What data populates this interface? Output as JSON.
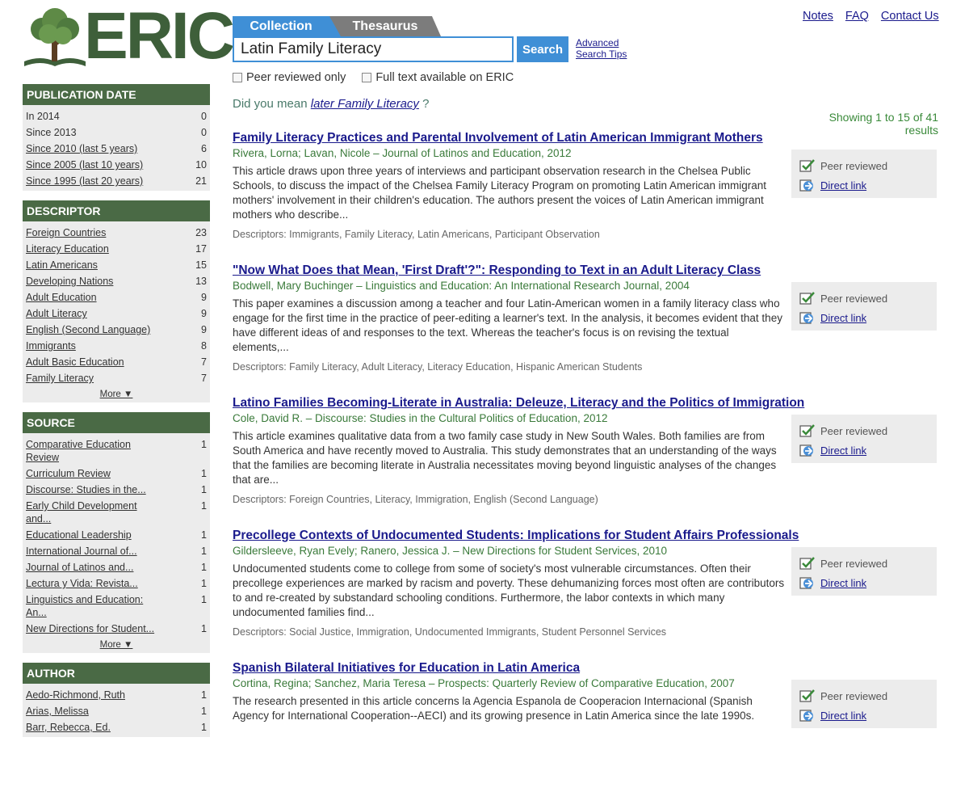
{
  "brand": {
    "logo_text": "ERIC"
  },
  "top_links": [
    "Notes",
    "FAQ",
    "Contact Us"
  ],
  "tabs": {
    "collection": "Collection",
    "thesaurus": "Thesaurus"
  },
  "search": {
    "value": "Latin Family Literacy",
    "button": "Search",
    "advanced": "Advanced",
    "tips": "Search Tips"
  },
  "filters": {
    "peer_reviewed": "Peer reviewed only",
    "full_text": "Full text available on ERIC"
  },
  "did_you_mean": {
    "prefix": "Did you mean",
    "suggestion": "later Family Literacy",
    "suffix": "?"
  },
  "showing": "Showing 1 to 15 of 41 results",
  "facets": {
    "pub_date": {
      "title": "PUBLICATION DATE",
      "items": [
        {
          "label": "In 2014",
          "count": "0",
          "link": false
        },
        {
          "label": "Since 2013",
          "count": "0",
          "link": false
        },
        {
          "label": "Since 2010 (last 5 years)",
          "count": "6",
          "link": true
        },
        {
          "label": "Since 2005 (last 10 years)",
          "count": "10",
          "link": true
        },
        {
          "label": "Since 1995 (last 20 years)",
          "count": "21",
          "link": true
        }
      ]
    },
    "descriptor": {
      "title": "DESCRIPTOR",
      "more": "More ▼",
      "items": [
        {
          "label": "Foreign Countries",
          "count": "23"
        },
        {
          "label": "Literacy Education",
          "count": "17"
        },
        {
          "label": "Latin Americans",
          "count": "15"
        },
        {
          "label": "Developing Nations",
          "count": "13"
        },
        {
          "label": "Adult Education",
          "count": "9"
        },
        {
          "label": "Adult Literacy",
          "count": "9"
        },
        {
          "label": "English (Second Language)",
          "count": "9"
        },
        {
          "label": "Immigrants",
          "count": "8"
        },
        {
          "label": "Adult Basic Education",
          "count": "7"
        },
        {
          "label": "Family Literacy",
          "count": "7"
        }
      ]
    },
    "source": {
      "title": "SOURCE",
      "more": "More ▼",
      "items": [
        {
          "label": "Comparative Education Review",
          "count": "1"
        },
        {
          "label": "Curriculum Review",
          "count": "1"
        },
        {
          "label": "Discourse: Studies in the...",
          "count": "1"
        },
        {
          "label": "Early Child Development and...",
          "count": "1"
        },
        {
          "label": "Educational Leadership",
          "count": "1"
        },
        {
          "label": "International Journal of...",
          "count": "1"
        },
        {
          "label": "Journal of Latinos and...",
          "count": "1"
        },
        {
          "label": "Lectura y Vida: Revista...",
          "count": "1"
        },
        {
          "label": "Linguistics and Education: An...",
          "count": "1"
        },
        {
          "label": "New Directions for Student...",
          "count": "1"
        }
      ]
    },
    "author": {
      "title": "AUTHOR",
      "items": [
        {
          "label": "Aedo-Richmond, Ruth",
          "count": "1"
        },
        {
          "label": "Arias, Melissa",
          "count": "1"
        },
        {
          "label": "Barr, Rebecca, Ed.",
          "count": "1"
        }
      ]
    }
  },
  "result_labels": {
    "peer": "Peer reviewed",
    "direct": "Direct link"
  },
  "results": [
    {
      "title": "Family Literacy Practices and Parental Involvement of Latin American Immigrant Mothers",
      "meta": "Rivera, Lorna; Lavan, Nicole – Journal of Latinos and Education, 2012",
      "abstract": "This article draws upon three years of interviews and participant observation research in the Chelsea Public Schools, to discuss the impact of the Chelsea Family Literacy Program on promoting Latin American immigrant mothers' involvement in their children's education. The authors present the voices of Latin American immigrant mothers who describe...",
      "descriptors": "Descriptors: Immigrants, Family Literacy, Latin Americans, Participant Observation"
    },
    {
      "title": "\"Now What Does that Mean, 'First Draft'?\": Responding to Text in an Adult Literacy Class",
      "meta": "Bodwell, Mary Buchinger – Linguistics and Education: An International Research Journal, 2004",
      "abstract": "This paper examines a discussion among a teacher and four Latin-American women in a family literacy class who engage for the first time in the practice of peer-editing a learner's text. In the analysis, it becomes evident that they have different ideas of and responses to the text. Whereas the teacher's focus is on revising the textual elements,...",
      "descriptors": "Descriptors: Family Literacy, Adult Literacy, Literacy Education, Hispanic American Students"
    },
    {
      "title": "Latino Families Becoming-Literate in Australia: Deleuze, Literacy and the Politics of Immigration",
      "meta": "Cole, David R. – Discourse: Studies in the Cultural Politics of Education, 2012",
      "abstract": "This article examines qualitative data from a two family case study in New South Wales. Both families are from South America and have recently moved to Australia. This study demonstrates that an understanding of the ways that the families are becoming literate in Australia necessitates moving beyond linguistic analyses of the changes that are...",
      "descriptors": "Descriptors: Foreign Countries, Literacy, Immigration, English (Second Language)"
    },
    {
      "title": "Precollege Contexts of Undocumented Students: Implications for Student Affairs Professionals",
      "meta": "Gildersleeve, Ryan Evely; Ranero, Jessica J. – New Directions for Student Services, 2010",
      "abstract": "Undocumented students come to college from some of society's most vulnerable circumstances. Often their precollege experiences are marked by racism and poverty. These dehumanizing forces most often are contributors to and re-created by substandard schooling conditions. Furthermore, the labor contexts in which many undocumented families find...",
      "descriptors": "Descriptors: Social Justice, Immigration, Undocumented Immigrants, Student Personnel Services"
    },
    {
      "title": "Spanish Bilateral Initiatives for Education in Latin America",
      "meta": "Cortina, Regina; Sanchez, Maria Teresa – Prospects: Quarterly Review of Comparative Education, 2007",
      "abstract": "The research presented in this article concerns la Agencia Espanola de Cooperacion Internacional (Spanish Agency for International Cooperation--AECI) and its growing presence in Latin America since the late 1990s.",
      "descriptors": ""
    }
  ]
}
